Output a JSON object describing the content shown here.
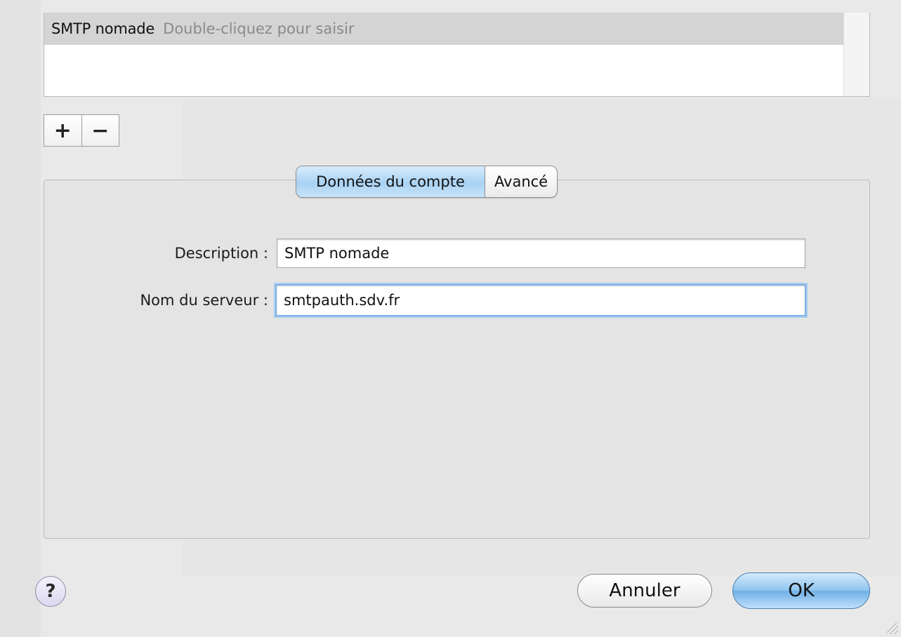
{
  "server_list": {
    "rows": [
      {
        "name": "SMTP nomade",
        "hint": "Double-cliquez pour saisir"
      }
    ]
  },
  "list_controls": {
    "add_label": "+",
    "remove_label": "−"
  },
  "tabs": [
    {
      "label": "Données du compte",
      "active": true
    },
    {
      "label": "Avancé",
      "active": false
    }
  ],
  "form": {
    "description_label": "Description :",
    "description_value": "SMTP nomade",
    "server_label": "Nom du serveur :",
    "server_value": "smtpauth.sdv.fr"
  },
  "footer": {
    "help_label": "?",
    "cancel_label": "Annuler",
    "ok_label": "OK"
  },
  "colors": {
    "accent_blue": "#8dc3ee",
    "selected_row": "#d4d4d4",
    "help_button": "#dcd8ee"
  }
}
